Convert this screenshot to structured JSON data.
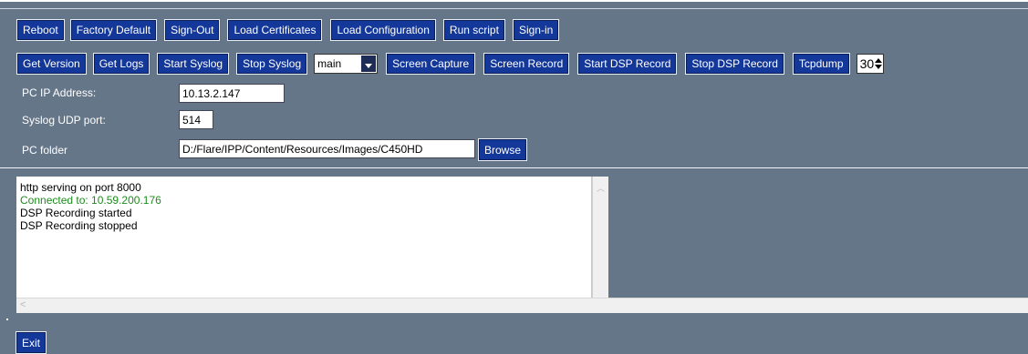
{
  "row1": {
    "buttons": [
      "Reboot",
      "Factory Default",
      "Sign-Out",
      "Load Certificates",
      "Load Configuration",
      "Run script",
      "Sign-in"
    ]
  },
  "row2": {
    "buttons_before": [
      "Get Version",
      "Get Logs",
      "Start Syslog",
      "Stop Syslog"
    ],
    "target_select": "main",
    "buttons_after": [
      "Screen Capture",
      "Screen Record",
      "Start DSP Record",
      "Stop DSP Record",
      "Tcpdump"
    ],
    "duration_value": "30"
  },
  "fields": {
    "pc_ip_label": "PC IP Address:",
    "pc_ip_value": "10.13.2.147",
    "syslog_port_label": "Syslog UDP port:",
    "syslog_port_value": "514",
    "pc_folder_label": "PC folder",
    "pc_folder_value": "D:/Flare/IPP/Content/Resources/Images/C450HD",
    "browse_label": "Browse"
  },
  "log": {
    "lines": [
      {
        "text": "http serving on port  8000",
        "color": "#000000"
      },
      {
        "text": "Connected to: 10.59.200.176",
        "color": "#1f8b1f"
      },
      {
        "text": "DSP Recording started",
        "color": "#000000"
      },
      {
        "text": "DSP Recording stopped",
        "color": "#000000"
      }
    ]
  },
  "footer": {
    "exit_label": "Exit"
  },
  "colors": {
    "background": "#667689",
    "button": "#14389a",
    "log_connected": "#1f8b1f"
  }
}
